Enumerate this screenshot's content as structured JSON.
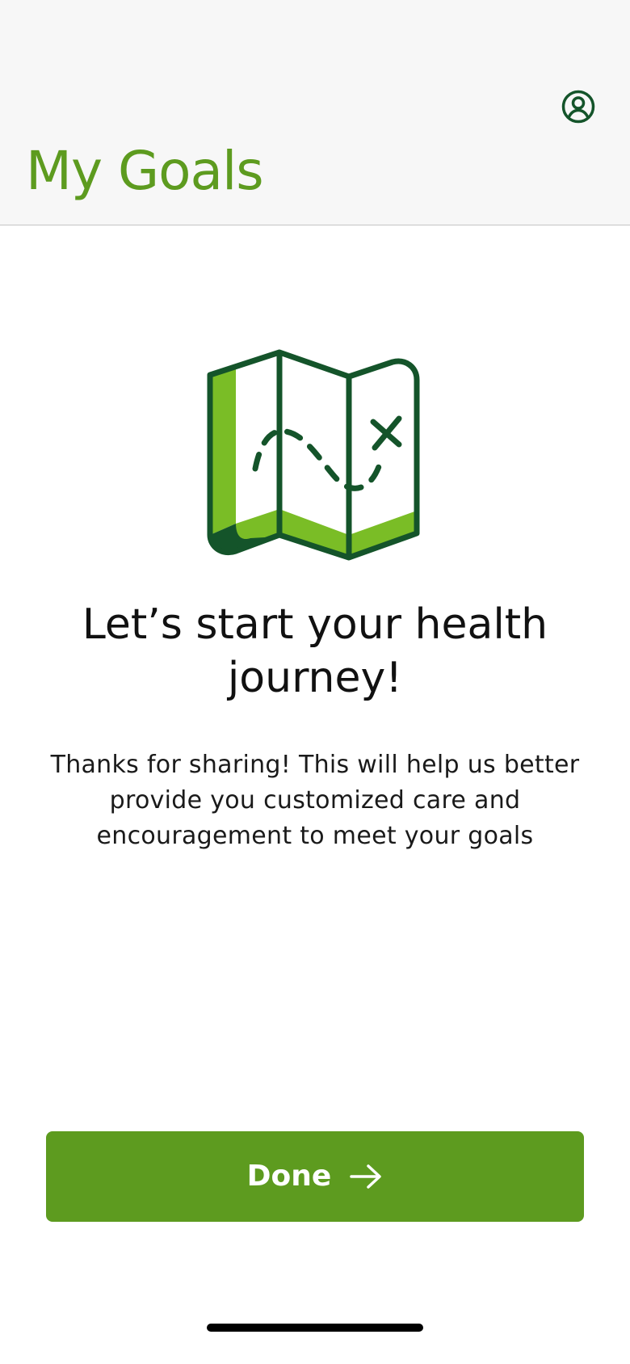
{
  "header": {
    "title": "My Goals",
    "profile_icon": "account-circle-icon",
    "background_color": "#f7f7f7"
  },
  "illustration": {
    "icon": "treasure-map-icon",
    "primary_color": "#14542a",
    "accent_color": "#7abd26"
  },
  "main": {
    "headline": "Let’s start your health journey!",
    "message": "Thanks for sharing! This will help us better provide you customized care and encouragement to meet your goals"
  },
  "footer": {
    "done_label": "Done",
    "done_icon": "arrow-right-icon",
    "button_color": "#5d9b1f"
  },
  "colors": {
    "brand_green": "#5d9b1f",
    "dark_green": "#14542a",
    "light_green": "#7abd26"
  }
}
